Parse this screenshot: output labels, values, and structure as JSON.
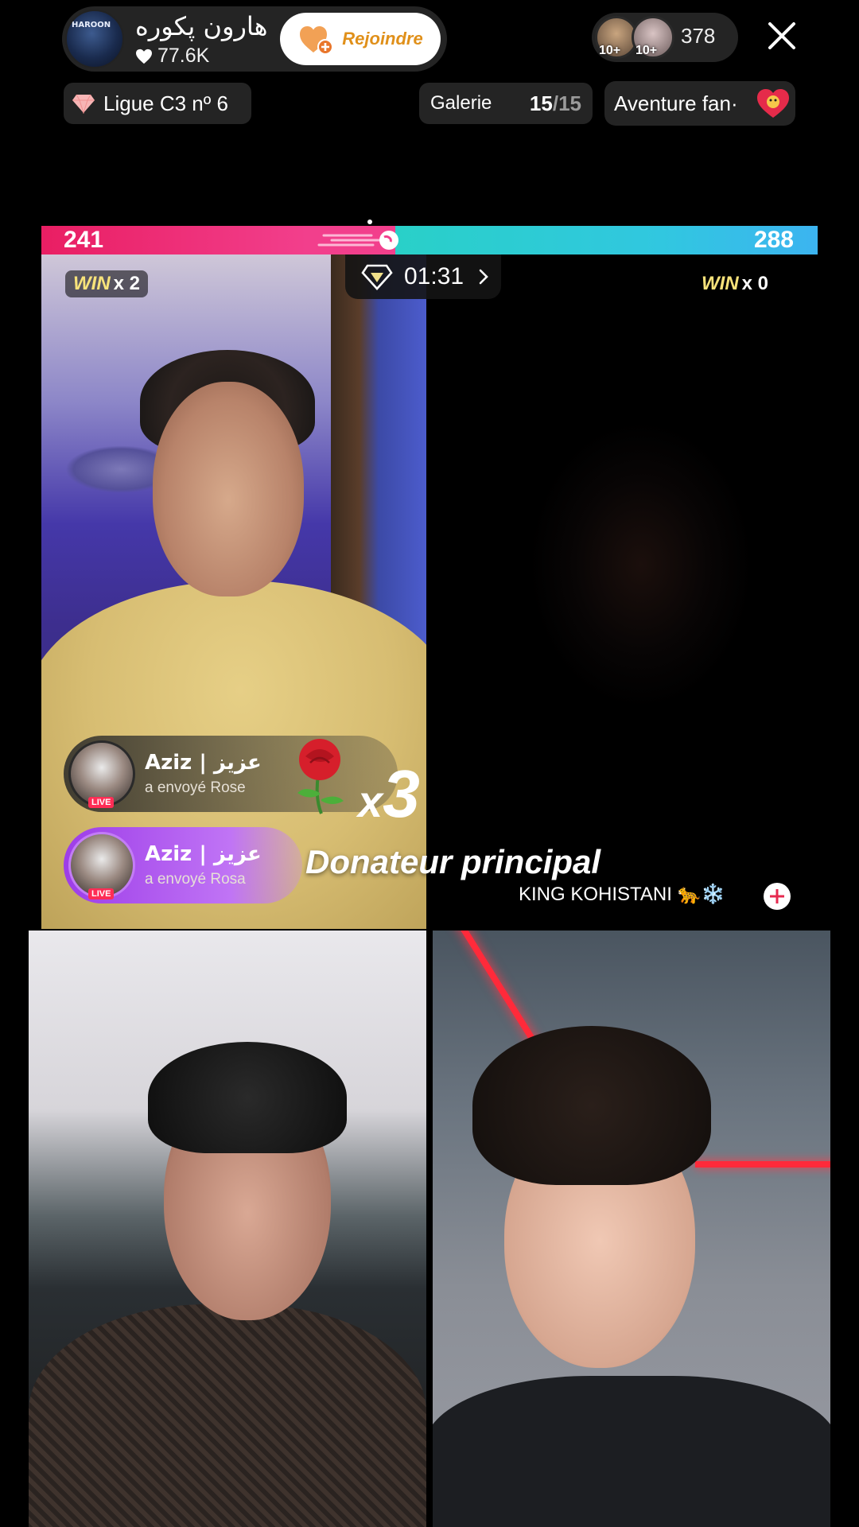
{
  "host": {
    "name": "هارون پکوره",
    "likes": "77.6K",
    "join_label": "Rejoindre",
    "avatar_text": "HAROON"
  },
  "viewers": {
    "count": "378",
    "badges": [
      "10+",
      "10+"
    ]
  },
  "league": {
    "label": "Ligue C3 nº 6"
  },
  "gallery": {
    "label": "Galerie",
    "current": "15",
    "total": "/15"
  },
  "fan": {
    "label": "Aventure fan·"
  },
  "battle": {
    "left_score": "241",
    "right_score": "288",
    "left_share": 0.456,
    "timer": "01:31",
    "left_color": "#e91e63",
    "right_color": "#31c7e0"
  },
  "wins": {
    "left_word": "WIN",
    "left_count": "x 2",
    "right_word": "WIN",
    "right_count": "x 0"
  },
  "gifts": [
    {
      "user": "Aziz | عزيز",
      "action": "a envoyé  Rose",
      "live": "LIVE"
    },
    {
      "user": "Aziz | عزيز",
      "action": "a envoyé  Rosa",
      "live": "LIVE"
    }
  ],
  "combo": {
    "x": "x",
    "n": "3"
  },
  "top_donor": {
    "label": "Donateur principal",
    "name": "KING KOHISTANI 🐆❄️"
  },
  "icons": [
    "heart-icon",
    "join-heart-icon",
    "close-icon",
    "gem-icon",
    "fan-heart-icon",
    "timer-gem-icon",
    "chevron-right-icon",
    "rose-icon",
    "plus-icon"
  ]
}
